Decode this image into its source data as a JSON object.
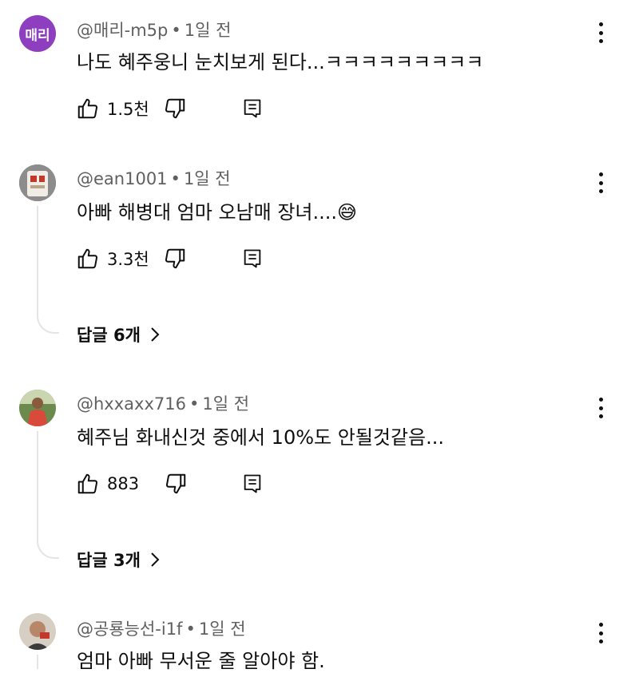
{
  "comments": [
    {
      "avatar_text": "매리",
      "avatar_color": "#8e3fbf",
      "handle": "@매리-m5p",
      "time": "1일 전",
      "text": "나도 혜주웅니 눈치보게 된다...ㅋㅋㅋㅋㅋㅋㅋㅋㅋ",
      "likes": "1.5천"
    },
    {
      "avatar_icon": "photo-avatar",
      "handle": "@ean1001",
      "time": "1일 전",
      "text": "아빠 해병대 엄마 오남매 장녀....",
      "emoji": "😅",
      "likes": "3.3천",
      "replies": "답글 6개"
    },
    {
      "avatar_icon": "photo-avatar",
      "handle": "@hxxaxx716",
      "time": "1일 전",
      "text": "혜주님 화내신것 중에서 10%도 안될것같음...",
      "likes": "883",
      "replies": "답글 3개"
    },
    {
      "avatar_icon": "photo-avatar",
      "handle": "@공룡능선-i1f",
      "time": "1일 전",
      "text": "엄마 아빠 무서운 줄 알아야 함."
    }
  ],
  "separator": "•"
}
